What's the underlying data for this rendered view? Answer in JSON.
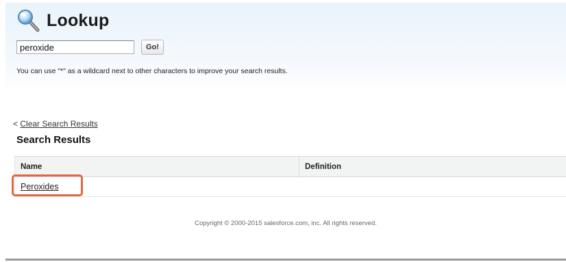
{
  "header": {
    "title": "Lookup",
    "icon": "magnifier-icon"
  },
  "search": {
    "value": "peroxide",
    "placeholder": "",
    "go_label": "Go!",
    "hint": "You can use \"*\" as a wildcard next to other characters to improve your search results."
  },
  "results": {
    "clear_prefix": "<",
    "clear_link": "Clear Search Results",
    "heading": "Search Results",
    "columns": [
      "Name",
      "Definition"
    ],
    "rows": [
      {
        "name": "Peroxides",
        "definition": ""
      }
    ]
  },
  "footer": {
    "copyright": "Copyright © 2000-2015 salesforce.com, inc. All rights reserved."
  },
  "colors": {
    "highlight": "#e4673f",
    "header_gradient_top": "#e9f3fb"
  }
}
